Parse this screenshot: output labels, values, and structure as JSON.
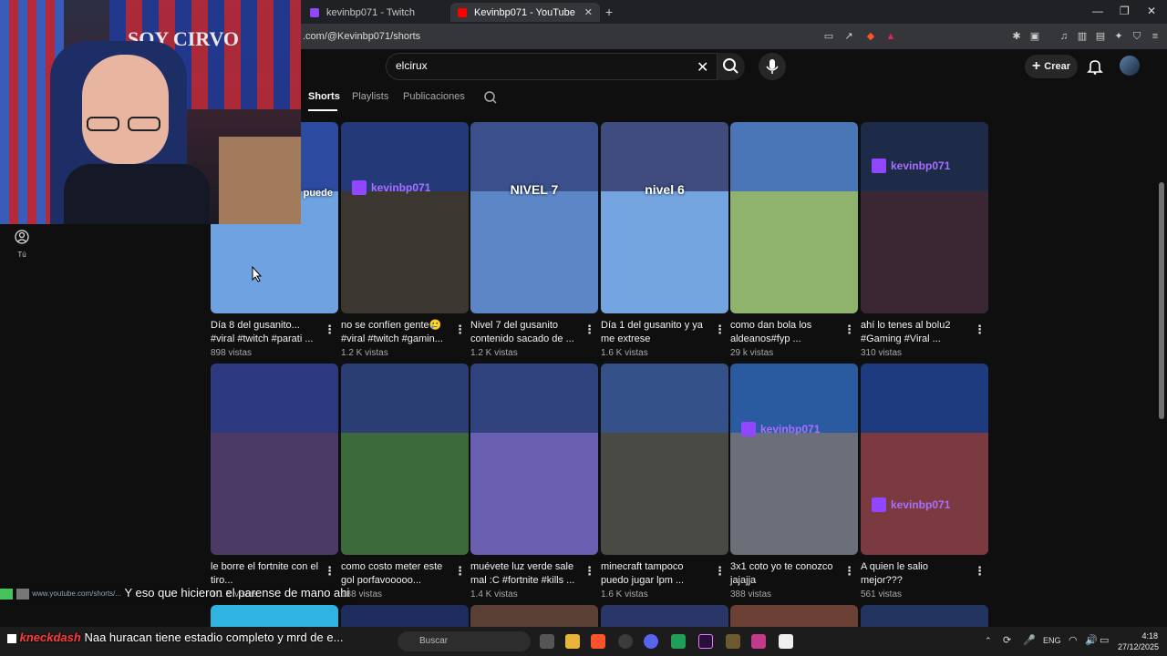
{
  "browser": {
    "tabs": [
      {
        "label": "kevinbp071 - Twitch",
        "favicon_color": "#9146ff"
      },
      {
        "label": "Kevinbp071 - YouTube",
        "favicon_color": "#ff0000"
      }
    ],
    "new_tab_icon": "plus-icon",
    "url": ".com/@Kevinbp071/shorts"
  },
  "youtube": {
    "search": {
      "value": "elcirux"
    },
    "create_label": "Crear",
    "channel_tabs": [
      "Shorts",
      "Playlists",
      "Publicaciones"
    ],
    "sidebar_you_label": "Tú"
  },
  "shorts_row1": [
    {
      "title": "Día 8 del gusanito... #viral #twitch #parati ...",
      "views": "898 vistas",
      "overlay": "puede",
      "top_color": "#2b4aa0",
      "bot_color": "#6fa2e0"
    },
    {
      "title": "no se confíen gente🥲 #viral #twitch #gamin...",
      "views": "1.2 K vistas",
      "overlay": "kevinbp071",
      "top_color": "#243a78",
      "bot_color": "#3b3730"
    },
    {
      "title": "Nivel 7 del gusanito contenido sacado de ...",
      "views": "1.2 K vistas",
      "overlay": "NIVEL 7",
      "top_color": "#3a4f8c",
      "bot_color": "#5d86c6"
    },
    {
      "title": "Día 1 del gusanito y ya me extrese",
      "views": "1.6 K vistas",
      "overlay": "nivel 6",
      "top_color": "#3f4c7d",
      "bot_color": "#74a5e0"
    },
    {
      "title": "como dan bola los aldeanos#fyp ...",
      "views": "29 k vistas",
      "overlay": "",
      "top_color": "#4a76b8",
      "bot_color": "#8fb26c"
    },
    {
      "title": "ahí lo tenes al bolu2 #Gaming #Viral ...",
      "views": "310 vistas",
      "overlay": "kevinbp071",
      "top_color": "#1d2a48",
      "bot_color": "#3b2734"
    }
  ],
  "shorts_row2": [
    {
      "title": "le borre el fortnite con el tiro...",
      "views": "1.1 K vistas",
      "top_color": "#2d3a80",
      "bot_color": "#4b3a66"
    },
    {
      "title": "como costo meter este gol  porfavooooo...",
      "views": "188 vistas",
      "top_color": "#2b3e74",
      "bot_color": "#3d6a3a"
    },
    {
      "title": "muévete luz verde sale mal :C #fortnite #kills ...",
      "views": "1.4 K vistas",
      "top_color": "#30437e",
      "bot_color": "#6a5fb0"
    },
    {
      "title": "minecraft tampoco puedo jugar lpm ...",
      "views": "1.6 K vistas",
      "top_color": "#34518a",
      "bot_color": "#4a4a44"
    },
    {
      "title": "3x1 coto yo te conozco jajajja",
      "views": "388 vistas",
      "overlay": "kevinbp071",
      "top_color": "#2a5aa0",
      "bot_color": "#6b6f7a"
    },
    {
      "title": "A quien le salio mejor???",
      "views": "561 vistas",
      "overlay": "kevinbp071",
      "top_color": "#1f3b80",
      "bot_color": "#7a3a40"
    }
  ],
  "webcam": {
    "banner": "SOY CIRVO"
  },
  "chat": [
    {
      "user": "",
      "link": "www.youtube.com/shorts/...",
      "message": "Y eso que hicieron el parense de mano ahi"
    },
    {
      "user": "kneckdash",
      "message": "Naa huracan tiene estadio completo y mrd de e..."
    }
  ],
  "taskbar": {
    "search_placeholder": "Buscar",
    "lang": "ENG",
    "time": "4:18",
    "date": "27/12/2025"
  }
}
